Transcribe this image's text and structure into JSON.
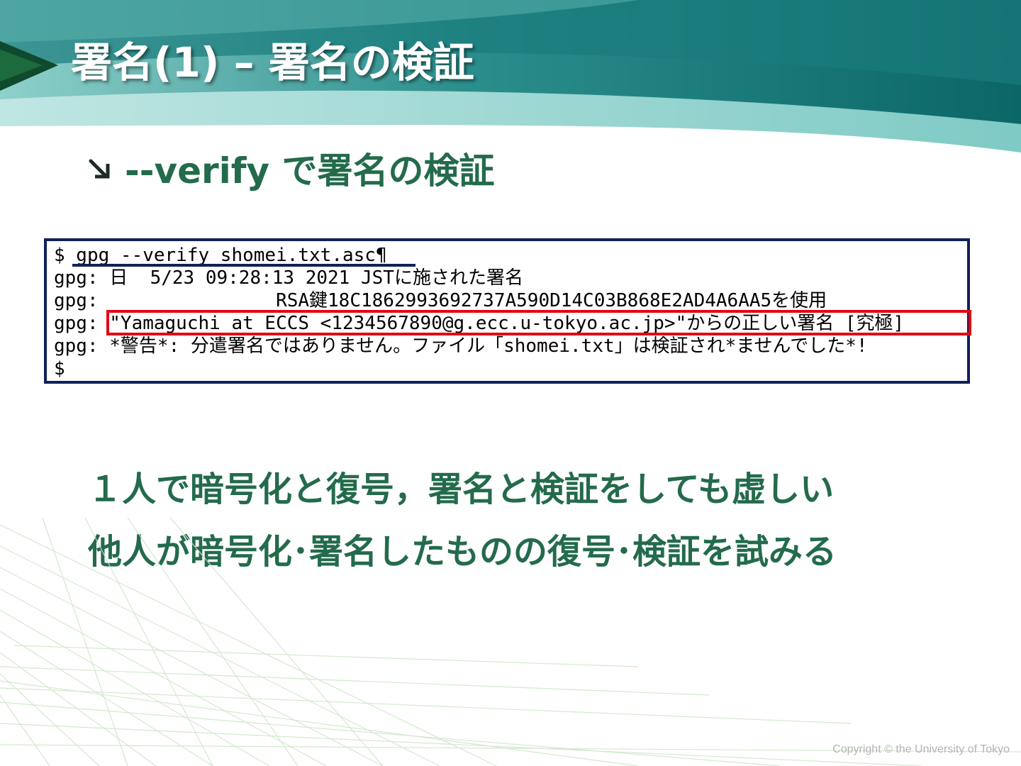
{
  "slide": {
    "title": "署名(1) – 署名の検証",
    "bullet": "--verify で署名の検証",
    "bullet_icon": "arrow-down-right-icon"
  },
  "terminal": {
    "lines": [
      "$ gpg --verify shomei.txt.asc¶",
      "gpg: 日  5/23 09:28:13 2021 JSTに施された署名",
      "gpg:                RSA鍵18C1862993692737A590D14C03B868E2AD4A6AA5を使用",
      "gpg: \"Yamaguchi at ECCS <1234567890@g.ecc.u-tokyo.ac.jp>\"からの正しい署名 [究極]",
      "gpg: *警告*: 分遣署名ではありません。ファイル「shomei.txt」は検証され*ませんでした*!",
      "$"
    ]
  },
  "notes": [
    "１人で暗号化と復号，署名と検証をしても虚しい",
    "他人が暗号化･署名したものの復号･検証を試みる"
  ],
  "footer": {
    "copyright": "Copyright © the University of Tokyo"
  },
  "colors": {
    "title_text": "#ffffff",
    "accent_green": "#236b4b",
    "terminal_border": "#10205a",
    "highlight_red": "#e30613",
    "header_teal": "#1f8a88"
  }
}
